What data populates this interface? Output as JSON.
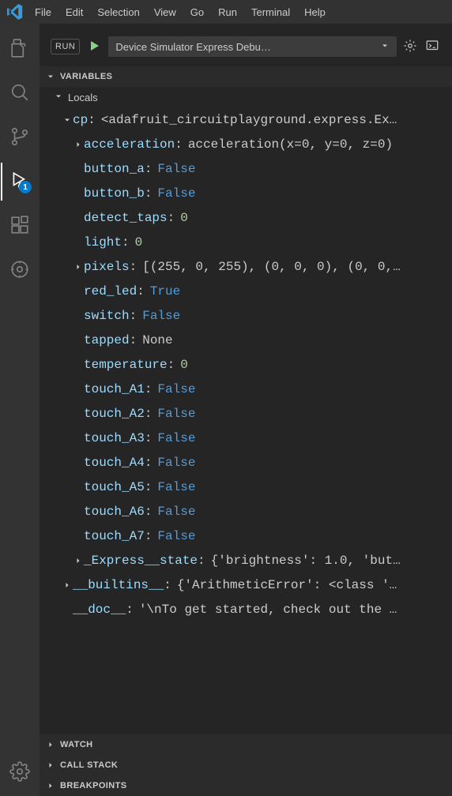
{
  "menu": {
    "items": [
      "File",
      "Edit",
      "Selection",
      "View",
      "Go",
      "Run",
      "Terminal",
      "Help"
    ]
  },
  "activity": {
    "debug_badge": "1"
  },
  "debug": {
    "run_label": "RUN",
    "config_selected": "Device Simulator Express Debu…"
  },
  "sections": {
    "variables": "VARIABLES",
    "watch": "WATCH",
    "callstack": "CALL STACK",
    "breakpoints": "BREAKPOINTS"
  },
  "scope": {
    "locals": "Locals"
  },
  "vars": {
    "cp": {
      "name": "cp",
      "value": "<adafruit_circuitplayground.express.Ex…"
    },
    "acceleration": {
      "name": "acceleration",
      "value": "acceleration(x=0, y=0, z=0)"
    },
    "button_a": {
      "name": "button_a",
      "value": "False"
    },
    "button_b": {
      "name": "button_b",
      "value": "False"
    },
    "detect_taps": {
      "name": "detect_taps",
      "value": "0"
    },
    "light": {
      "name": "light",
      "value": "0"
    },
    "pixels": {
      "name": "pixels",
      "value": "[(255, 0, 255), (0, 0, 0), (0, 0,…"
    },
    "red_led": {
      "name": "red_led",
      "value": "True"
    },
    "switch": {
      "name": "switch",
      "value": "False"
    },
    "tapped": {
      "name": "tapped",
      "value": "None"
    },
    "temperature": {
      "name": "temperature",
      "value": "0"
    },
    "touch_A1": {
      "name": "touch_A1",
      "value": "False"
    },
    "touch_A2": {
      "name": "touch_A2",
      "value": "False"
    },
    "touch_A3": {
      "name": "touch_A3",
      "value": "False"
    },
    "touch_A4": {
      "name": "touch_A4",
      "value": "False"
    },
    "touch_A5": {
      "name": "touch_A5",
      "value": "False"
    },
    "touch_A6": {
      "name": "touch_A6",
      "value": "False"
    },
    "touch_A7": {
      "name": "touch_A7",
      "value": "False"
    },
    "express_state": {
      "name": "_Express__state",
      "value": "{'brightness': 1.0, 'but…"
    },
    "builtins": {
      "name": "__builtins__",
      "value": "{'ArithmeticError': <class '…"
    },
    "doc": {
      "name": "__doc__",
      "value": "'\\nTo get started, check out the …"
    }
  }
}
